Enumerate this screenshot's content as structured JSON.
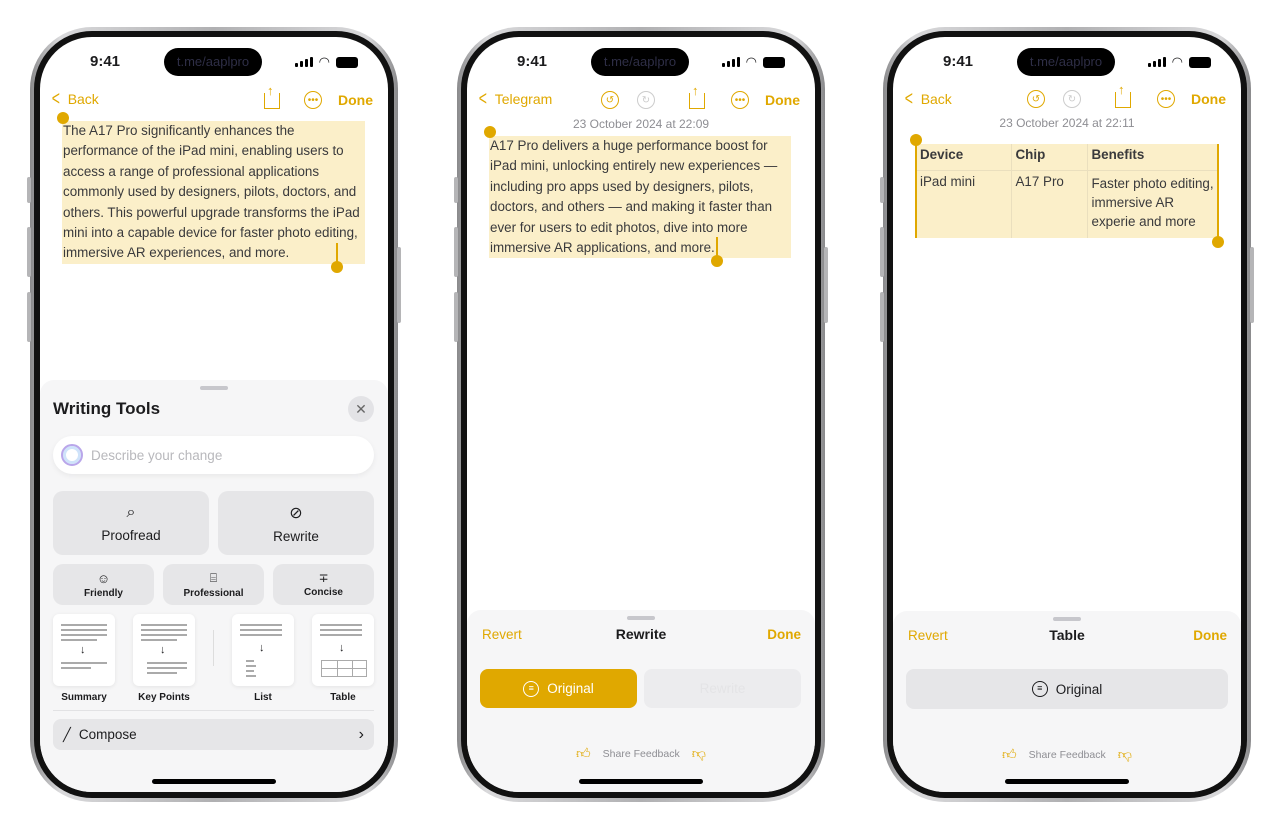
{
  "colors": {
    "accent": "#e0a800",
    "selection": "#fbefc9"
  },
  "watermark": "t.me/aaplpro",
  "phones": [
    {
      "status": {
        "time": "9:41"
      },
      "nav": {
        "back": "Back",
        "done": "Done",
        "icons": [
          "chevron-left-icon",
          "share-icon",
          "more-icon"
        ]
      },
      "text": "The A17 Pro significantly enhances the performance of the iPad mini, enabling users to access a range of professional applications commonly used by designers, pilots, doctors, and others. This powerful upgrade transforms the iPad mini into a capable device for faster photo editing, immersive AR experiences, and more.",
      "writing_tools": {
        "title": "Writing Tools",
        "placeholder": "Describe your change",
        "primary": [
          {
            "label": "Proofread",
            "icon": "proofread-icon"
          },
          {
            "label": "Rewrite",
            "icon": "rewrite-icon"
          }
        ],
        "tones": [
          {
            "label": "Friendly",
            "icon": "smiley-icon"
          },
          {
            "label": "Professional",
            "icon": "briefcase-icon"
          },
          {
            "label": "Concise",
            "icon": "concise-icon"
          }
        ],
        "formats": [
          {
            "label": "Summary"
          },
          {
            "label": "Key Points"
          },
          {
            "label": "List"
          },
          {
            "label": "Table"
          }
        ],
        "compose": "Compose"
      }
    },
    {
      "status": {
        "time": "9:41"
      },
      "nav": {
        "back": "Telegram",
        "done": "Done",
        "icons": [
          "undo-icon",
          "redo-icon",
          "share-icon",
          "more-icon"
        ]
      },
      "date": "23 October 2024 at 22:09",
      "text": "A17 Pro delivers a huge performance boost for iPad mini, unlocking entirely new experiences — including pro apps used by designers, pilots, doctors, and others — and making it faster than ever for users to edit photos, dive into more immersive AR applications, and more.",
      "sheet": {
        "revert": "Revert",
        "title": "Rewrite",
        "done": "Done",
        "original": "Original",
        "rewrite": "Rewrite",
        "feedback": "Share Feedback"
      }
    },
    {
      "status": {
        "time": "9:41"
      },
      "nav": {
        "back": "Back",
        "done": "Done",
        "icons": [
          "undo-icon",
          "redo-icon",
          "share-icon",
          "more-icon"
        ]
      },
      "date": "23 October 2024 at 22:11",
      "table": {
        "headers": [
          "Device",
          "Chip",
          "Benefits"
        ],
        "rows": [
          [
            "iPad mini",
            "A17 Pro",
            "Faster photo editing, immersive AR experie and more"
          ]
        ]
      },
      "sheet": {
        "revert": "Revert",
        "title": "Table",
        "done": "Done",
        "original": "Original",
        "feedback": "Share Feedback"
      }
    }
  ]
}
